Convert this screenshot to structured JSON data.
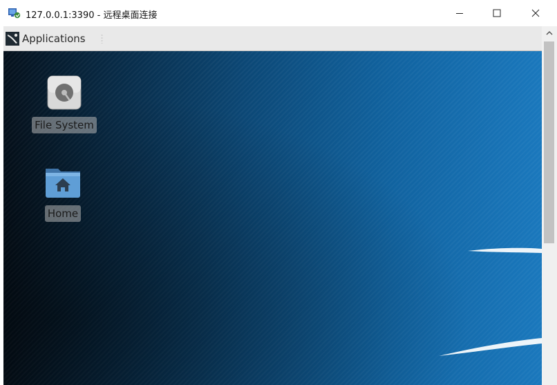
{
  "window": {
    "title": "127.0.0.1:3390 - 远程桌面连接",
    "icon": "remote-desktop-icon",
    "controls": {
      "minimize": "—",
      "maximize": "☐",
      "close": "✕"
    }
  },
  "panel": {
    "applications_label": "Applications",
    "applications_icon": "xfce-mouse-icon"
  },
  "desktop": {
    "icons": [
      {
        "label": "File System",
        "icon": "drive-harddisk-icon"
      },
      {
        "label": "Home",
        "icon": "folder-home-icon"
      }
    ],
    "colors": {
      "bg_dark": "#05111c",
      "bg_light": "#1a78bd"
    }
  },
  "scrollbar": {
    "up_arrow": "^"
  }
}
